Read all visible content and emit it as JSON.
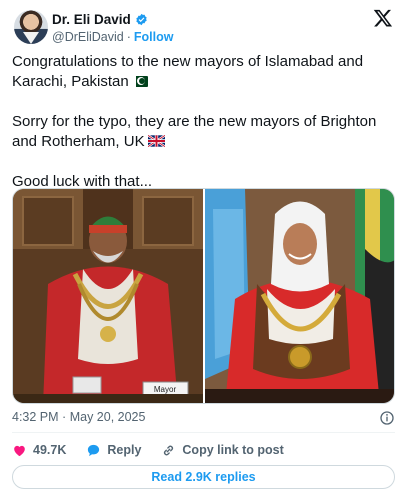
{
  "author": {
    "name": "Dr. Eli David",
    "handle": "@DrEliDavid",
    "separator": "·",
    "follow_label": "Follow"
  },
  "tweet": {
    "line1": "Congratulations to the new mayors of Islamabad and Karachi, Pakistan",
    "line2": "Sorry for the typo, they are the new mayors of Brighton and Rotherham, UK",
    "line3": "Good luck with that..."
  },
  "media": {
    "left_placard": "Mayor"
  },
  "meta": {
    "time": "4:32 PM",
    "separator": "·",
    "date": "May 20, 2025"
  },
  "actions": {
    "likes": "49.7K",
    "reply_label": "Reply",
    "copy_link_label": "Copy link to post"
  },
  "replies_button": "Read 2.9K replies",
  "colors": {
    "accent": "#1d9bf0",
    "like": "#f91880",
    "text": "#0f1419",
    "secondary": "#536471"
  }
}
